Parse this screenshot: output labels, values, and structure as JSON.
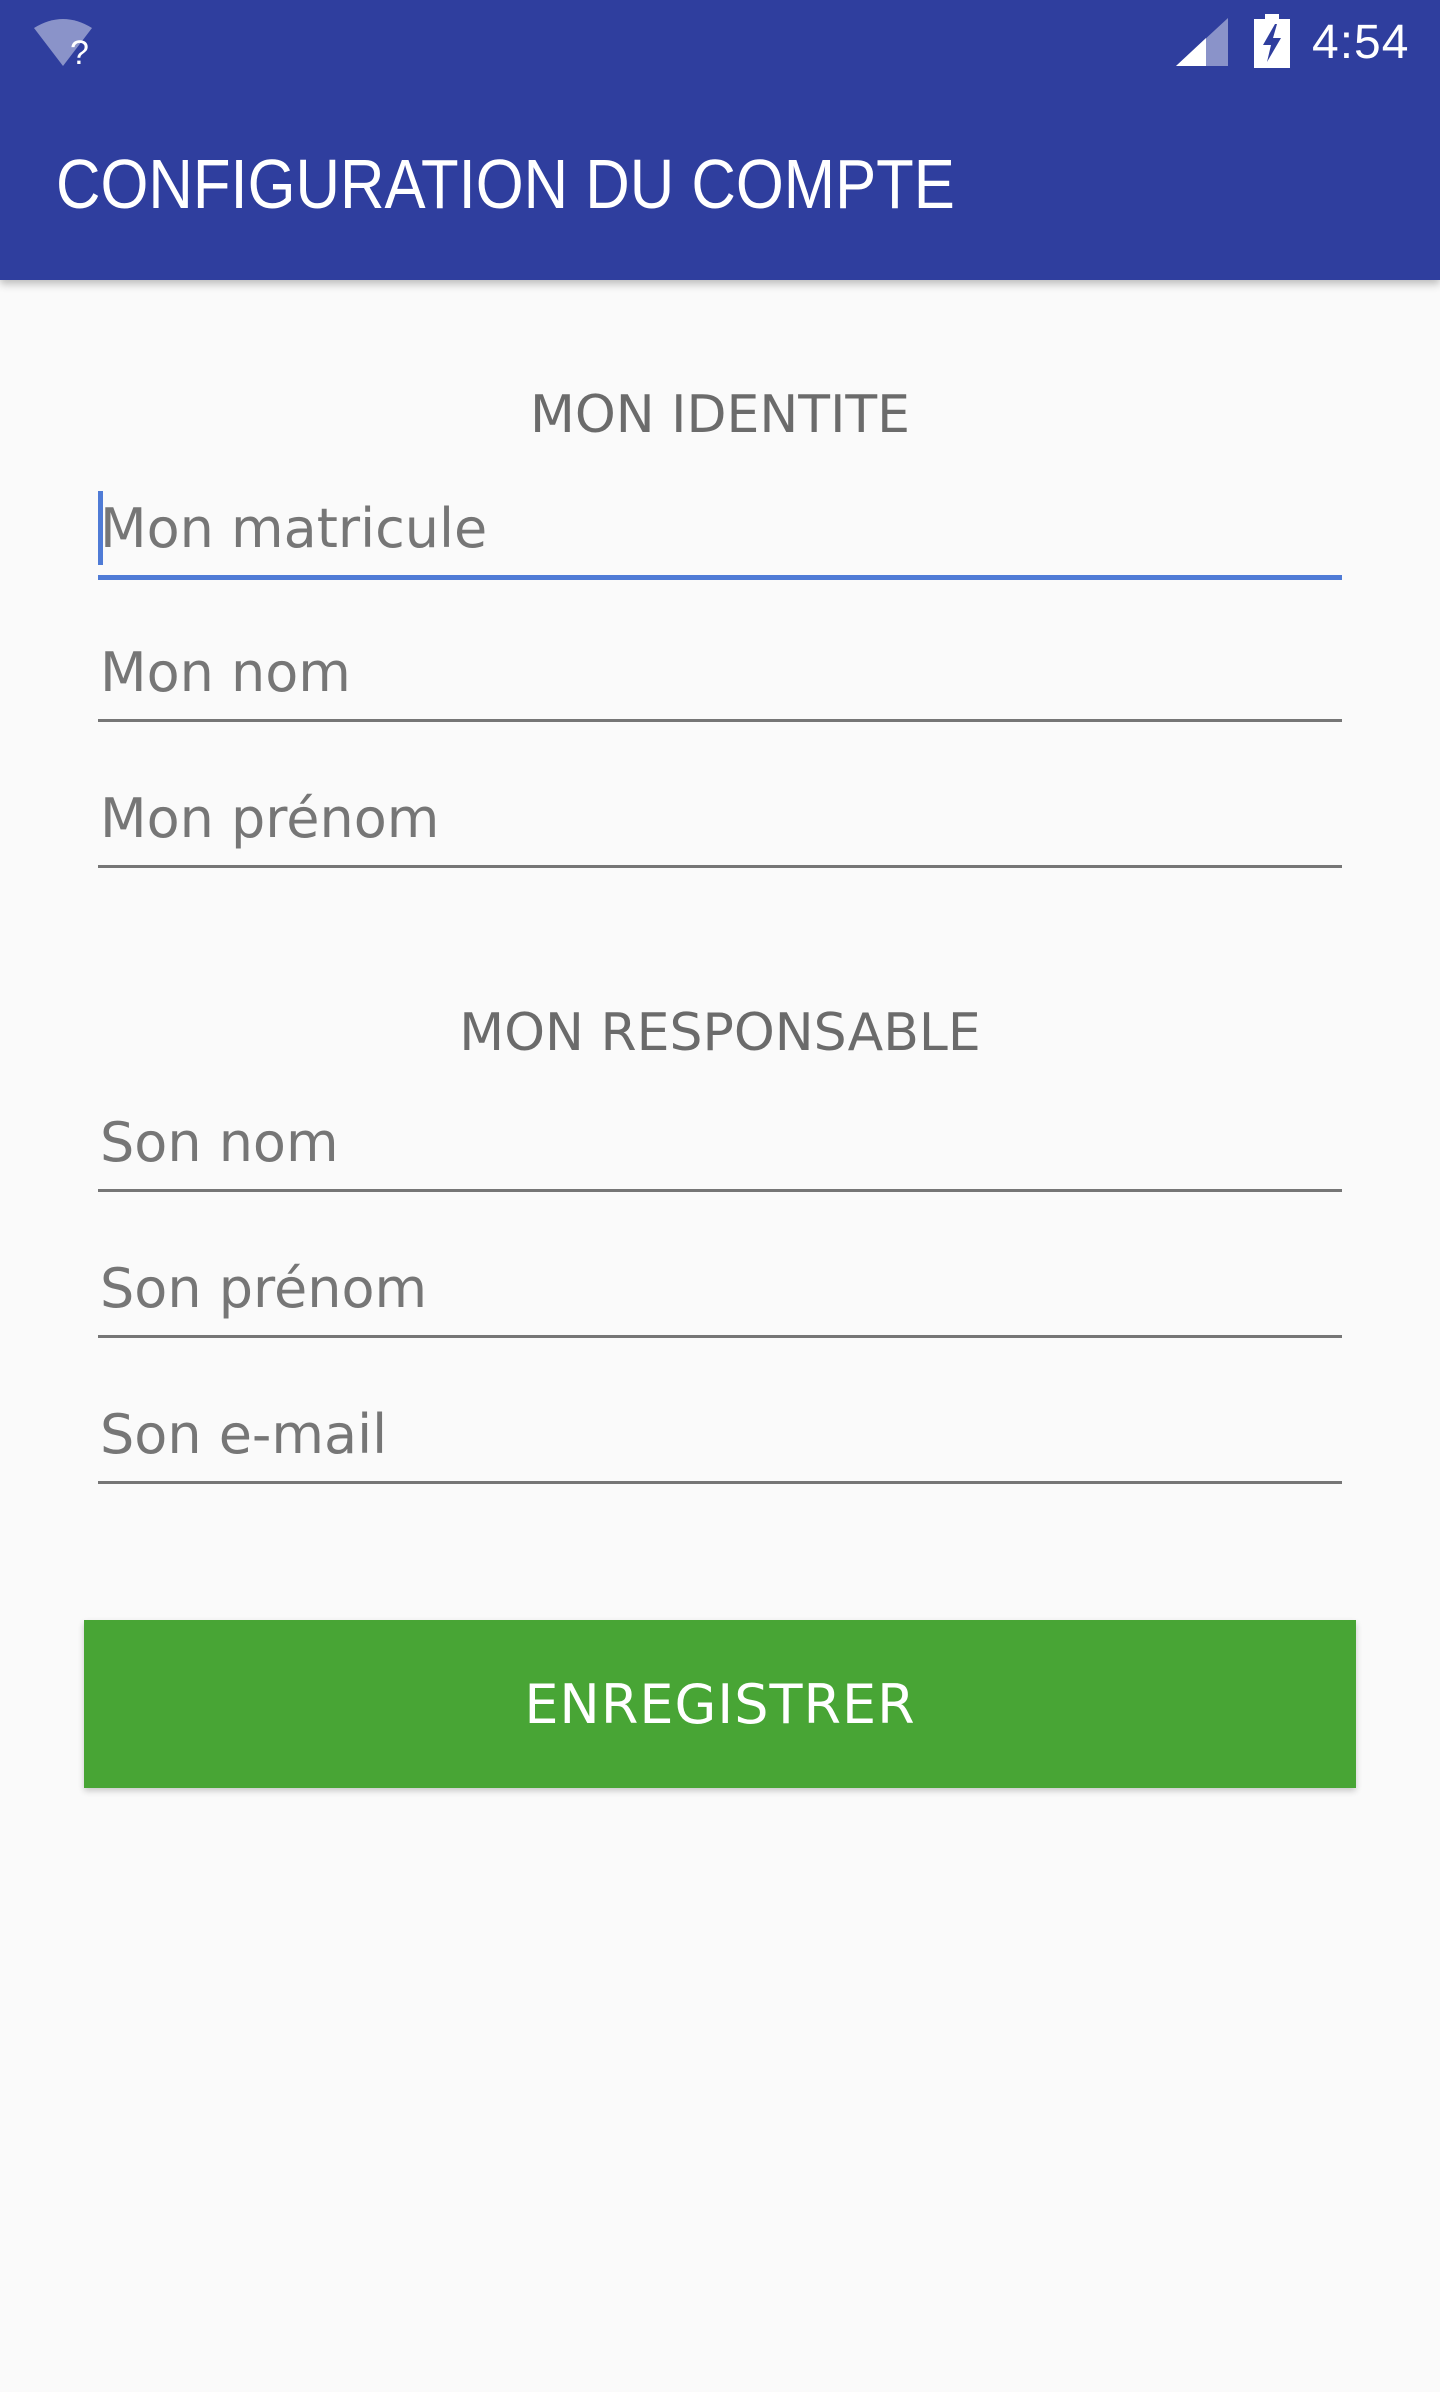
{
  "status_bar": {
    "time": "4:54",
    "icons": [
      "wifi-unknown-icon",
      "signal-icon",
      "battery-charging-icon"
    ]
  },
  "app_bar": {
    "title": "CONFIGURATION DU COMPTE",
    "color": "#2f3e9e"
  },
  "identity_section": {
    "title": "MON IDENTITE",
    "fields": [
      {
        "placeholder": "Mon matricule",
        "value": "",
        "focused": true
      },
      {
        "placeholder": "Mon nom",
        "value": ""
      },
      {
        "placeholder": "Mon prénom",
        "value": ""
      }
    ]
  },
  "manager_section": {
    "title": "MON RESPONSABLE",
    "fields": [
      {
        "placeholder": "Son nom",
        "value": ""
      },
      {
        "placeholder": "Son prénom",
        "value": ""
      },
      {
        "placeholder": "Son e-mail",
        "value": ""
      }
    ]
  },
  "save_button": {
    "label": "ENREGISTRER",
    "color": "#48a535"
  },
  "accent_color": "#4f7bd6"
}
